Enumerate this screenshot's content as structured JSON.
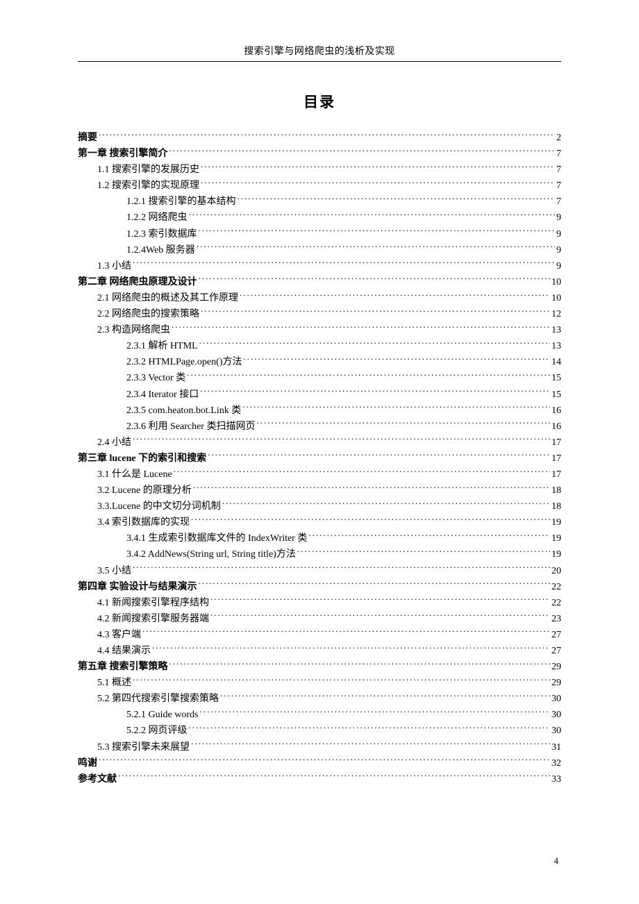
{
  "header": "搜索引擎与网络爬虫的浅析及实现",
  "toc_heading": "目录",
  "page_number": "4",
  "entries": [
    {
      "label": "摘要",
      "page": "2",
      "level": 0,
      "bold": true
    },
    {
      "label": "第一章  搜索引擎简介",
      "page": "7",
      "level": 0,
      "bold": true
    },
    {
      "label": "1.1 搜索引擎的发展历史",
      "page": "7",
      "level": 1,
      "bold": false
    },
    {
      "label": "1.2 搜索引擎的实现原理",
      "page": "7",
      "level": 1,
      "bold": false
    },
    {
      "label": "1.2.1 搜索引擎的基本结构",
      "page": "7",
      "level": 2,
      "bold": false
    },
    {
      "label": "1.2.2 网络爬虫",
      "page": "9",
      "level": 2,
      "bold": false
    },
    {
      "label": "1.2.3 索引数据库",
      "page": "9",
      "level": 2,
      "bold": false
    },
    {
      "label": "1.2.4Web 服务器",
      "page": "9",
      "level": 2,
      "bold": false
    },
    {
      "label": "1.3 小结",
      "page": "9",
      "level": 1,
      "bold": false
    },
    {
      "label": "第二章  网络爬虫原理及设计",
      "page": "10",
      "level": 0,
      "bold": true
    },
    {
      "label": "2.1 网络爬虫的概述及其工作原理",
      "page": "10",
      "level": 1,
      "bold": false
    },
    {
      "label": "2.2 网络爬虫的搜索策略",
      "page": "12",
      "level": 1,
      "bold": false
    },
    {
      "label": "2.3 构造网络爬虫",
      "page": "13",
      "level": 1,
      "bold": false
    },
    {
      "label": "2.3.1 解析 HTML",
      "page": "13",
      "level": 2,
      "bold": false
    },
    {
      "label": "2.3.2  HTMLPage.open()方法",
      "page": "14",
      "level": 2,
      "bold": false
    },
    {
      "label": "2.3.3  Vector 类",
      "page": "15",
      "level": 2,
      "bold": false
    },
    {
      "label": "2.3.4  Iterator 接口",
      "page": "15",
      "level": 2,
      "bold": false
    },
    {
      "label": "2.3.5  com.heaton.bot.Link 类",
      "page": "16",
      "level": 2,
      "bold": false
    },
    {
      "label": "2.3.6 利用 Searcher 类扫描网页",
      "page": "16",
      "level": 2,
      "bold": false
    },
    {
      "label": "2.4 小结",
      "page": "17",
      "level": 1,
      "bold": false
    },
    {
      "label": "第三章   lucene 下的索引和搜索",
      "page": "17",
      "level": 0,
      "bold": true
    },
    {
      "label": "3.1 什么是 Lucene",
      "page": "17",
      "level": 1,
      "bold": false
    },
    {
      "label": "3.2  Lucene 的原理分析",
      "page": "18",
      "level": 1,
      "bold": false
    },
    {
      "label": "3.3.Lucene 的中文切分词机制",
      "page": "18",
      "level": 1,
      "bold": false
    },
    {
      "label": "3.4  索引数据库的实现",
      "page": "19",
      "level": 1,
      "bold": false
    },
    {
      "label": "3.4.1 生成索引数据库文件的 IndexWriter 类",
      "page": "19",
      "level": 2,
      "bold": false
    },
    {
      "label": "3.4.2  AddNews(String url, String title)方法",
      "page": "19",
      "level": 2,
      "bold": false
    },
    {
      "label": "3.5  小结",
      "page": "20",
      "level": 1,
      "bold": false
    },
    {
      "label": "第四章  实验设计与结果演示",
      "page": "22",
      "level": 0,
      "bold": true
    },
    {
      "label": "4.1  新闻搜索引擎程序结构",
      "page": "22",
      "level": 1,
      "bold": false
    },
    {
      "label": "4.2  新闻搜索引擎服务器端",
      "page": "23",
      "level": 1,
      "bold": false
    },
    {
      "label": "4.3 客户端",
      "page": "27",
      "level": 1,
      "bold": false
    },
    {
      "label": "4.4 结果演示",
      "page": "27",
      "level": 1,
      "bold": false
    },
    {
      "label": "第五章  搜索引擎策略",
      "page": "29",
      "level": 0,
      "bold": true
    },
    {
      "label": "5.1 概述",
      "page": "29",
      "level": 1,
      "bold": false
    },
    {
      "label": "5.2 第四代搜索引擎搜索策略",
      "page": "30",
      "level": 1,
      "bold": false
    },
    {
      "label": "5.2.1  Guide words",
      "page": "30",
      "level": 2,
      "bold": false
    },
    {
      "label": "5.2.2 网页评级",
      "page": "30",
      "level": 2,
      "bold": false
    },
    {
      "label": "5.3  搜索引擎未来展望",
      "page": "31",
      "level": 1,
      "bold": false
    },
    {
      "label": "鸣谢",
      "page": "32",
      "level": 0,
      "bold": true
    },
    {
      "label": "参考文献",
      "page": "33",
      "level": 0,
      "bold": true
    }
  ]
}
